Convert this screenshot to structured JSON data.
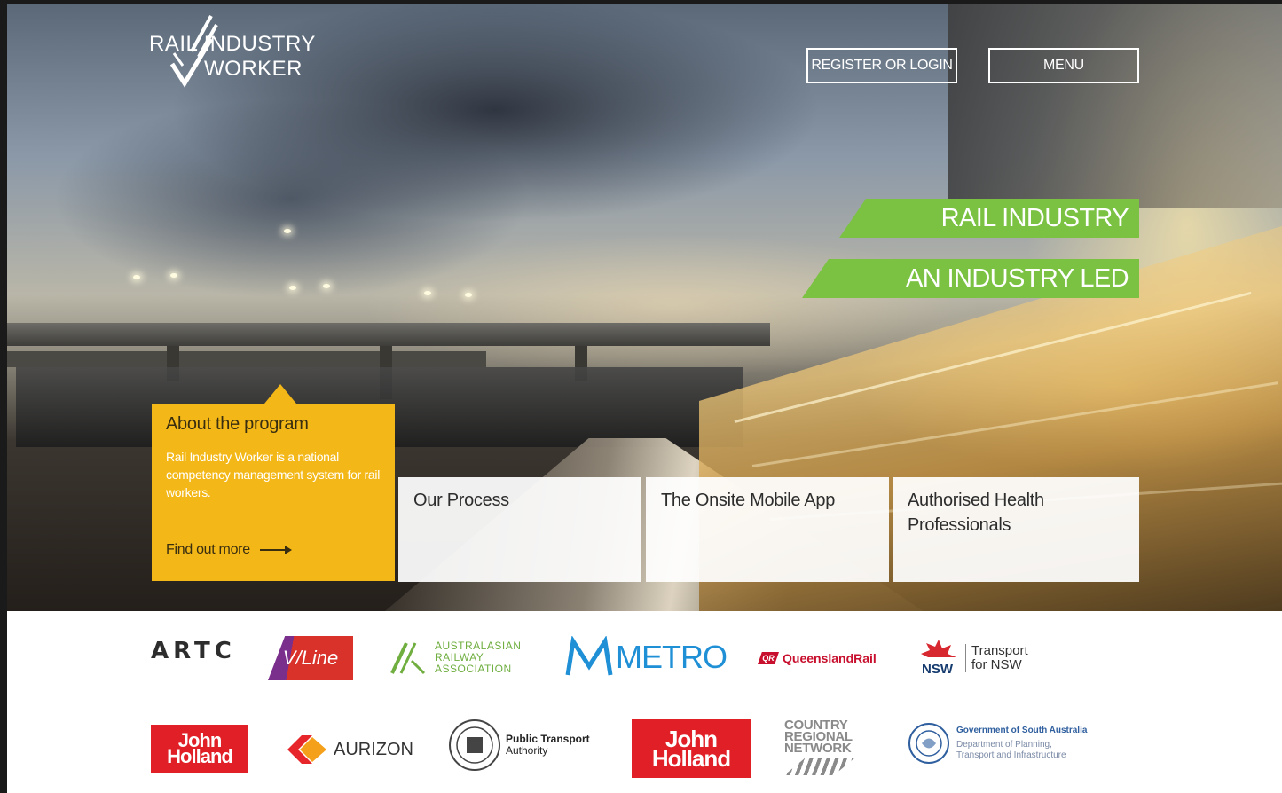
{
  "header": {
    "logo_line1": "RAIL INDUSTRY",
    "logo_line2": "WORKER",
    "register_label": "REGISTER OR LOGIN",
    "menu_label": "MENU"
  },
  "hero": {
    "tagline_1": "RAIL INDUSTRY WORKER",
    "tagline_2": "AN INDUSTRY LED SOLUTION"
  },
  "about": {
    "title": "About the program",
    "description": "Rail Industry Worker is a national competency management system for rail workers.",
    "link_label": "Find out more"
  },
  "cards": [
    {
      "label": "Our Process"
    },
    {
      "label": "The Onsite Mobile App"
    },
    {
      "label": "Authorised Health Professionals"
    }
  ],
  "partners": {
    "artc": "ARTC",
    "vline": "V/Line",
    "ara": [
      "AUSTRALASIAN",
      "RAILWAY",
      "ASSOCIATION"
    ],
    "metro": "METRO",
    "queensland_rail": "QueenslandRail",
    "qr_badge": "QR",
    "tfnsw_nsw": "NSW",
    "tfnsw": [
      "Transport",
      "for NSW"
    ],
    "john_holland": [
      "John",
      "Holland"
    ],
    "aurizon": "AURIZON",
    "pta": [
      "Public Transport",
      "Authority"
    ],
    "crn": [
      "COUNTRY",
      "REGIONAL",
      "NETWORK"
    ],
    "sa_gov": "Government of South Australia",
    "sa_dept": [
      "Department of Planning,",
      "Transport and Infrastructure"
    ]
  },
  "colors": {
    "accent_green": "#7bc242",
    "about_yellow": "#f3b717",
    "john_holland_red": "#e01f26",
    "metro_blue": "#1f8fd6"
  }
}
